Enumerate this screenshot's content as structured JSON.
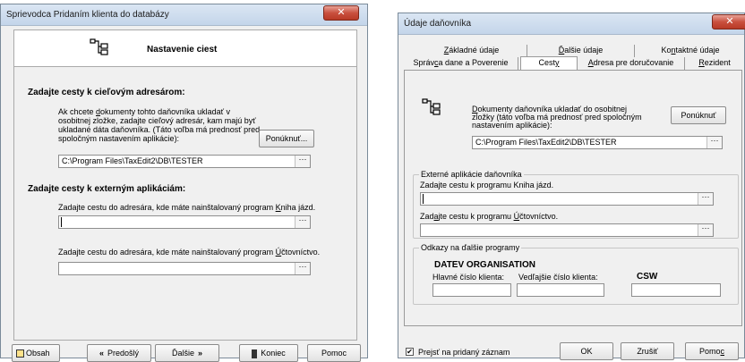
{
  "wizard": {
    "title": "Sprievodca Pridaním klienta do databázy",
    "header": "Nastavenie ciest",
    "section_target": "Zadajte cesty k cieľovým adresárom:",
    "target_description": [
      "Ak chcete dokumenty tohto daňovníka ukladať v",
      "osobitnej zložke, zadajte cieľový adresár, kam majú byť",
      "ukladané dáta daňovníka. (Táto voľba má prednosť pred",
      "spoločným nastavením aplikácie):"
    ],
    "offer_button": "Ponúknuť...",
    "path_value": "C:\\Program Files\\TaxEdit2\\DB\\TESTER",
    "section_external": "Zadajte cesty k externým aplikáciám:",
    "kniha_label": "Zadajte cestu do adresára, kde máte nainštalovaný program Kniha jázd.",
    "kniha_value": "",
    "uct_label": "Zadajte cestu do adresára, kde máte nainštalovaný program Účtovníctvo.",
    "uct_value": "",
    "buttons": {
      "contents": "Obsah",
      "previous": "Predošlý",
      "next": "Ďalšie",
      "finish": "Koniec",
      "help": "Pomoc"
    }
  },
  "dialog": {
    "title": "Údaje daňovníka",
    "tabs_row1": [
      "Základné údaje",
      "Ďalšie údaje",
      "Kontaktné údaje"
    ],
    "tabs_row2": [
      "Správca dane a Poverenie",
      "Cesty",
      "Adresa pre doručovanie",
      "Rezident"
    ],
    "doc_text": [
      "Dokumenty daňovníka ukladať do osobitnej",
      "zložky (táto voľba má prednosť pred spoločným",
      "nastavením aplikácie):"
    ],
    "offer_button": "Ponúknuť",
    "path_value": "C:\\Program Files\\TaxEdit2\\DB\\TESTER",
    "external_group": "Externé aplikácie daňovníka",
    "kniha_label": "Zadajte cestu k programu Kniha jázd.",
    "kniha_value": "",
    "uct_label": "Zadajte cestu k programu Účtovníctvo.",
    "uct_value": "",
    "links_group": "Odkazy na ďalšie programy",
    "datev": "DATEV ORGANISATION",
    "csw": "CSW",
    "main_client_label": "Hlavné číslo klienta:",
    "sub_client_label": "Vedľajšie číslo klienta:",
    "main_client_value": "",
    "sub_client_value": "",
    "csw_value": "",
    "checkbox_label": "Prejsť na pridaný záznam",
    "checkbox_checked": "✔",
    "buttons": {
      "ok": "OK",
      "cancel": "Zrušiť",
      "help": "Pomoc"
    }
  },
  "icons": {
    "close": "✕",
    "ellipsis": "···",
    "prev_arrows": "«",
    "next_arrows": "»"
  }
}
